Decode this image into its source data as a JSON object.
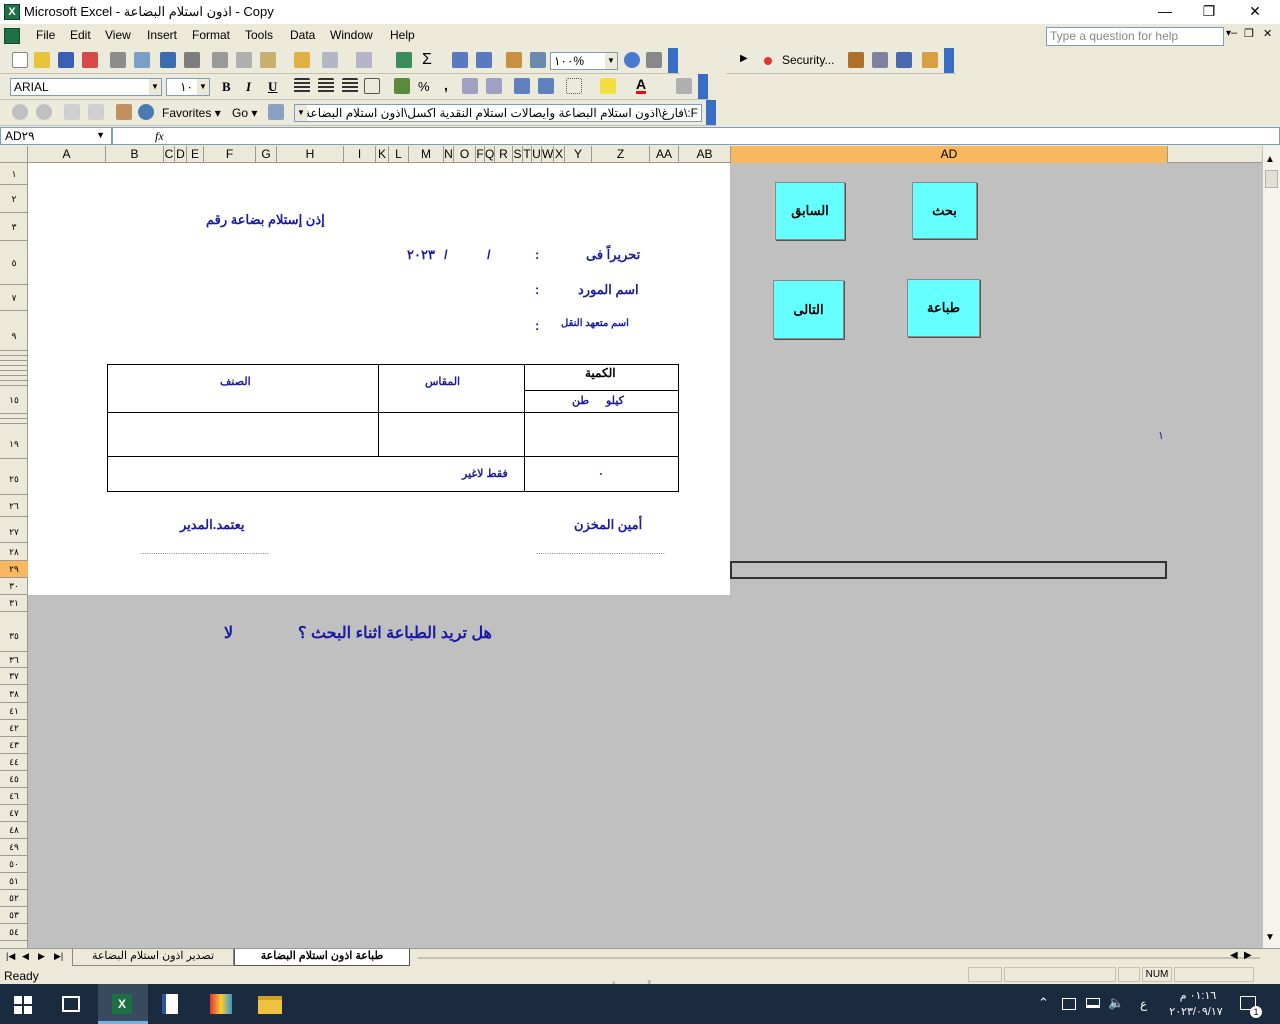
{
  "window": {
    "title": "Microsoft Excel - اذون استلام البضاعة - Copy",
    "controls": [
      "—",
      "❐",
      "✕"
    ]
  },
  "menu": {
    "items": [
      "File",
      "Edit",
      "View",
      "Insert",
      "Format",
      "Tools",
      "Data",
      "Window",
      "Help"
    ],
    "help_placeholder": "Type a question for help"
  },
  "toolbar": {
    "zoom": "١٠٠%",
    "security_label": "Security...",
    "font_name": "ARIAL",
    "font_size": "١٠",
    "bold": "B",
    "italic": "I",
    "underline": "U",
    "percent": "%",
    "comma": ",",
    "favorites": "Favorites",
    "go": "Go",
    "address": "F:\\فارغ\\اذون استلام البضاعة وايصالات استلام النقدية اكسل\\اذون استلام البضاعة"
  },
  "formula_bar": {
    "name_box": "AD٢٩",
    "fx": "fx",
    "formula": ""
  },
  "columns": [
    "A",
    "B",
    "C",
    "D",
    "E",
    "F",
    "G",
    "H",
    "I",
    "K",
    "L",
    "M",
    "N",
    "O",
    "F",
    "Q",
    "R",
    "S",
    "T",
    "U",
    "W",
    "X",
    "Y",
    "Z",
    "AA",
    "AB",
    "AD"
  ],
  "rows": [
    "١",
    "٢",
    "٣",
    "٥",
    "٧",
    "٩",
    "١٥",
    "١٩",
    "٢٥",
    "٢٦",
    "٢٧",
    "٢٨",
    "٢٩",
    "٣٠",
    "٣١",
    "٣٥",
    "٣٦",
    "٣٧",
    "٣٨",
    "٤١",
    "٤٢",
    "٤٣",
    "٤٤",
    "٤٥",
    "٤٦",
    "٤٧",
    "٤٨",
    "٤٩",
    "٥٠",
    "٥١",
    "٥٢",
    "٥٣",
    "٥٤"
  ],
  "form": {
    "title": "إذن إستلام بضاعة رقم",
    "date_label": "تحريراً فى",
    "colon": ":",
    "date_sep": "/",
    "date_year": "٢٠٢٣",
    "supplier_label": "اسم المورد",
    "carrier_label": "اسم متعهد النقل",
    "table": {
      "quantity": "الكمية",
      "kilo": "كيلو",
      "ton": "طن",
      "measure": "المقاس",
      "item": "الصنف",
      "total_value": "٠",
      "only_text": "فقط لاغير"
    },
    "storekeeper": "أمين المخزن",
    "manager": "يعتمد.المدير",
    "signature_dots": "..........................................................",
    "print_question": "هل تريد الطباعة اثناء البحث ؟",
    "print_answer": "لا",
    "counter": "١"
  },
  "buttons": {
    "previous": "السابق",
    "search": "بحث",
    "next": "التالى",
    "print": "طباعة"
  },
  "sheet_tabs": [
    "طباعة اذون استلام البضاعة",
    "تصدير اذون استلام البضاعة"
  ],
  "status": {
    "left": "Ready",
    "num": "NUM"
  },
  "watermark": "mostaql.com",
  "taskbar": {
    "time": "٠١:١٦ م",
    "date": "٢٠٢٣/٠٩/١٧",
    "lang": "ع",
    "notif_count": "1"
  },
  "colors": {
    "accent_blue": "#1a1aa0",
    "button_cyan": "#66ffff",
    "selected_col": "#f8b860"
  }
}
